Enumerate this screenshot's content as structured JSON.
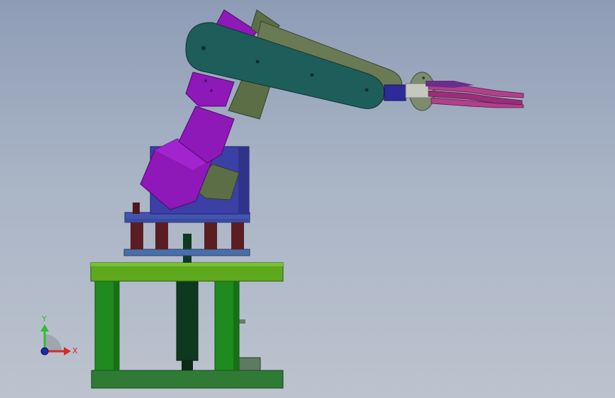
{
  "viewport": {
    "background_top": "#8e9cb6",
    "background_bottom": "#bcc3ce"
  },
  "triad": {
    "y_label": "Y",
    "x_label": "X",
    "y_color": "#2fbf2f",
    "x_color": "#d42a2a",
    "z_color": "#1e2aa8"
  },
  "model": {
    "colors": {
      "table_top": "#5ea81e",
      "table_legs": "#1f8a1f",
      "table_base": "#2f7a35",
      "center_column": "#0d3a1f",
      "base_plates": "#4a6fa8",
      "base_block": "#3b3fa6",
      "standoffs": "#5a1e22",
      "purple_links": "#8e18b8",
      "olive_links": "#5c6e45",
      "teal_arm": "#1e5e5a",
      "gripper_block": "#2e2a9a",
      "fingers": "#b0408a"
    }
  }
}
